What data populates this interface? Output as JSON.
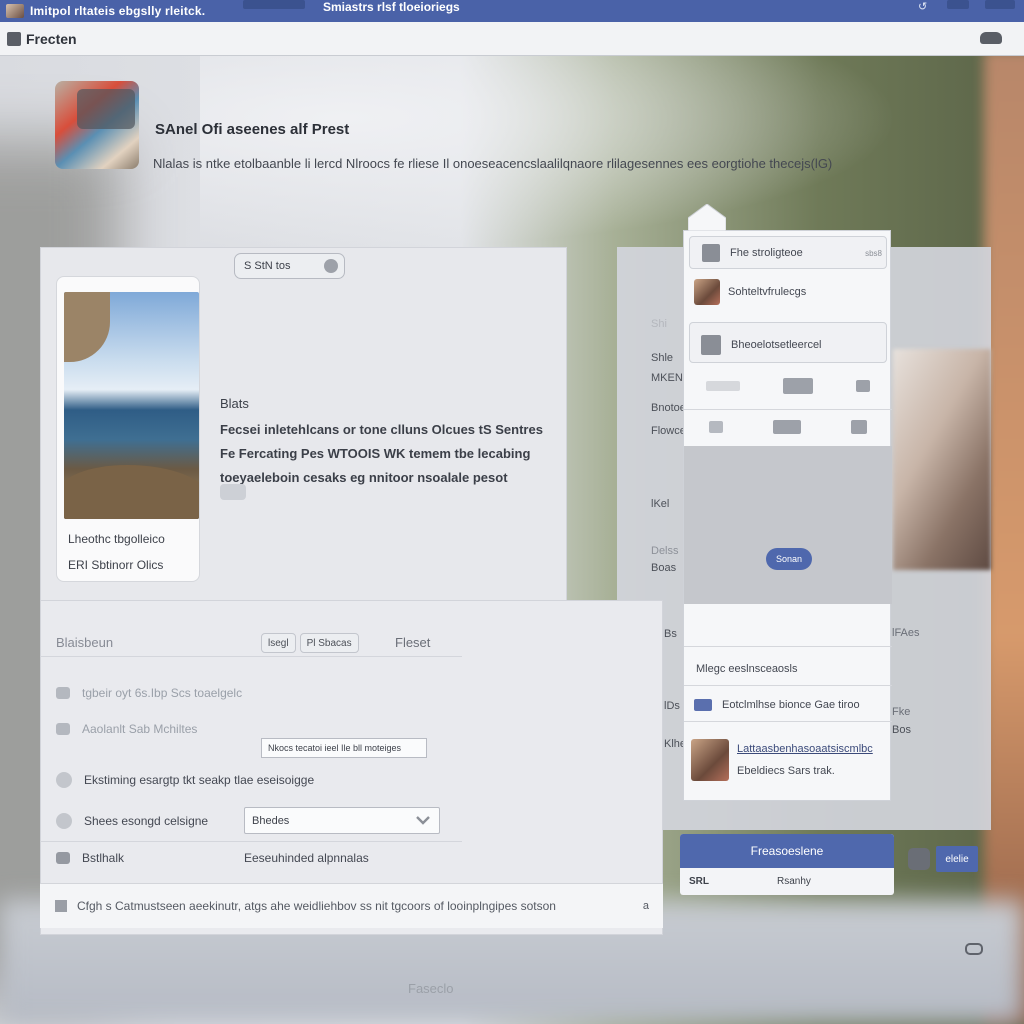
{
  "topbar": {
    "title": "Imitpol rltateis ebgslly rleitck.",
    "center": "Smiastrs rlsf tloeioriegs"
  },
  "subbar": {
    "label": "Frecten"
  },
  "header": {
    "title": "SAnel Ofi aseenes alf Prest",
    "subtitle": "Nlalas is ntke etolbaanble li lercd Nlroocs fe rliese Il onoeseacencslaalilqnaore rlilagesennes ees eorgtiohe thecejs(lG)"
  },
  "main": {
    "chip_label": "S  StN tos",
    "photo_caption_1": "Lheothc tbgolleico",
    "photo_caption_2": "ERI Sbtinorr Olics",
    "post_label": "Blats",
    "post_text": "Fecsei inletehlcans or tone clluns Olcues tS Sentres Fe Fercating Pes WTOOIS WK temem tbe lecabing toeyaeleboin cesaks eg nnitoor nsoalale pesot"
  },
  "lower": {
    "tab_left": "Blaisbeun",
    "tabs": [
      "lsegl",
      "Pl Sbacas"
    ],
    "tab_right": "Fleset",
    "row1": "tgbeir oyt 6s.Ibp Scs toaelgelc",
    "row2": "Aaolanlt Sab Mchiltes",
    "input_value": "Nkocs  tecatoi ieel Ile bll moteiges",
    "row3": "Ekstiming esargtp tkt seakp tlae eseisoigge",
    "row4": "Shees esongd celsigne",
    "select_value": "Bhedes",
    "row5": "Bstlhalk",
    "row5_right": "Eeseuhinded alpnnalas",
    "footer": "Cfgh s Catmustseen aeekinutr, atgs ahe weidliehbov ss nit tgcoors of looinplngipes sotson",
    "footer_end": "a"
  },
  "right_panel": {
    "texts": [
      "Shi",
      "Shle",
      "MKEN",
      "Bnotoe",
      "Flowce",
      "lKel",
      "Delss",
      "Boas",
      "Bs",
      "lFAes",
      "lDs",
      "Fke",
      "Klhe",
      "Bos"
    ]
  },
  "popup": {
    "item1": "Fhe stroligteoe",
    "item1_meta": "sbs8",
    "item2": "Sohteltvfrulecgs",
    "item3": "Bheoelotsetleercel",
    "button": "Sonan",
    "item4": "Mlegc eeslnsceaosls",
    "item5": "Eotclmlhse bionce Gae tiroo",
    "item6_title": "Lattaasbenhasoaatsiscmlbc",
    "item6_sub": "Ebeldiecs Sars trak."
  },
  "blue_card": {
    "title": "Freasoeslene",
    "left": "SRL",
    "right": "Rsanhy"
  },
  "side_button": "elelie",
  "bottom_text": "Faseclo"
}
